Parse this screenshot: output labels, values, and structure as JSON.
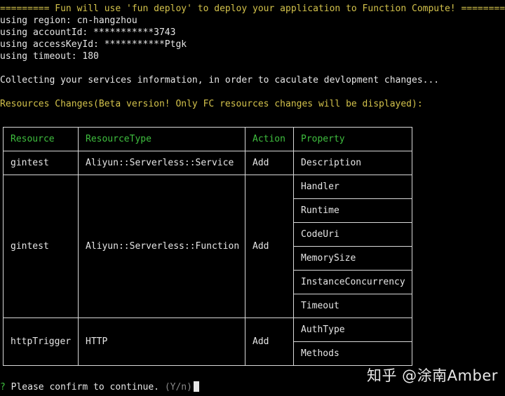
{
  "header_line": "========= Fun will use 'fun deploy' to deploy your application to Function Compute! =========",
  "config_lines": [
    "using region: cn-hangzhou",
    "using accountId: ***********3743",
    "using accessKeyId: ***********Ptgk",
    "using timeout: 180"
  ],
  "collecting_line": "Collecting your services information, in order to caculate devlopment changes...",
  "changes_line": "Resources Changes(Beta version! Only FC resources changes will be displayed):",
  "table": {
    "headers": [
      "Resource",
      "ResourceType",
      "Action",
      "Property"
    ],
    "groups": [
      {
        "resource": "gintest",
        "type": "Aliyun::Serverless::Service",
        "action": "Add",
        "properties": [
          "Description"
        ]
      },
      {
        "resource": "gintest",
        "type": "Aliyun::Serverless::Function",
        "action": "Add",
        "properties": [
          "Handler",
          "Runtime",
          "CodeUri",
          "MemorySize",
          "InstanceConcurrency",
          "Timeout"
        ]
      },
      {
        "resource": "httpTrigger",
        "type": "HTTP",
        "action": "Add",
        "properties": [
          "AuthType",
          "Methods"
        ]
      }
    ]
  },
  "prompt": {
    "mark": "?",
    "question": "Please confirm to continue.",
    "hint": "(Y/n)"
  },
  "watermark": "知乎 @涂南Amber",
  "colors": {
    "background": "#000000",
    "yellow": "#d3c24b",
    "green": "#3fbf3f",
    "text": "#e6e6e6"
  }
}
